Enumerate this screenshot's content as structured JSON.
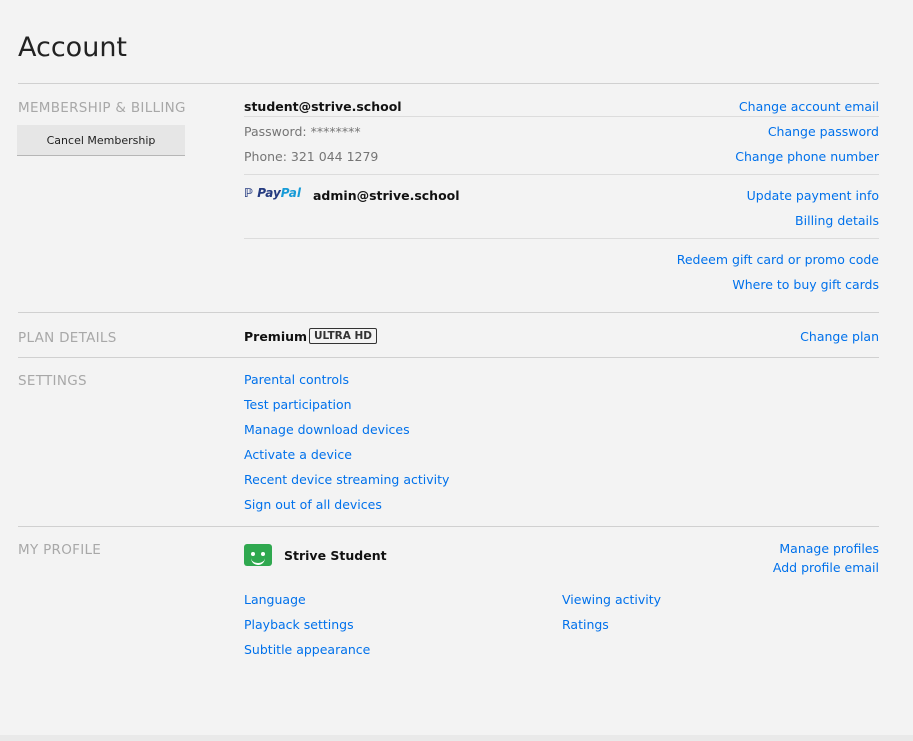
{
  "page": {
    "title": "Account"
  },
  "membership": {
    "heading": "MEMBERSHIP & BILLING",
    "cancel_label": "Cancel Membership",
    "email": "student@strive.school",
    "password": "Password: ********",
    "phone": "Phone: 321 044 1279",
    "change_email": "Change account email",
    "change_password": "Change password",
    "change_phone": "Change phone number",
    "paypal_a": "Pay",
    "paypal_b": "Pal",
    "payment_email": "admin@strive.school",
    "update_payment": "Update payment info",
    "billing_details": "Billing details",
    "redeem": "Redeem gift card or promo code",
    "where_to_buy": "Where to buy gift cards"
  },
  "plan": {
    "heading": "PLAN DETAILS",
    "name": "Premium",
    "badge": "ULTRA HD",
    "change_plan": "Change plan"
  },
  "settings": {
    "heading": "SETTINGS",
    "items": [
      "Parental controls",
      "Test participation",
      "Manage download devices",
      "Activate a device",
      "Recent device streaming activity",
      "Sign out of all devices"
    ]
  },
  "profile": {
    "heading": "MY PROFILE",
    "name": "Strive Student",
    "manage_profiles": "Manage profiles",
    "add_profile_email": "Add profile email",
    "left_links": [
      "Language",
      "Playback settings",
      "Subtitle appearance"
    ],
    "right_links": [
      "Viewing activity",
      "Ratings"
    ]
  },
  "colors": {
    "link": "#0071eb",
    "avatar": "#2fa84f",
    "section_heading": "#a8a8a8"
  }
}
